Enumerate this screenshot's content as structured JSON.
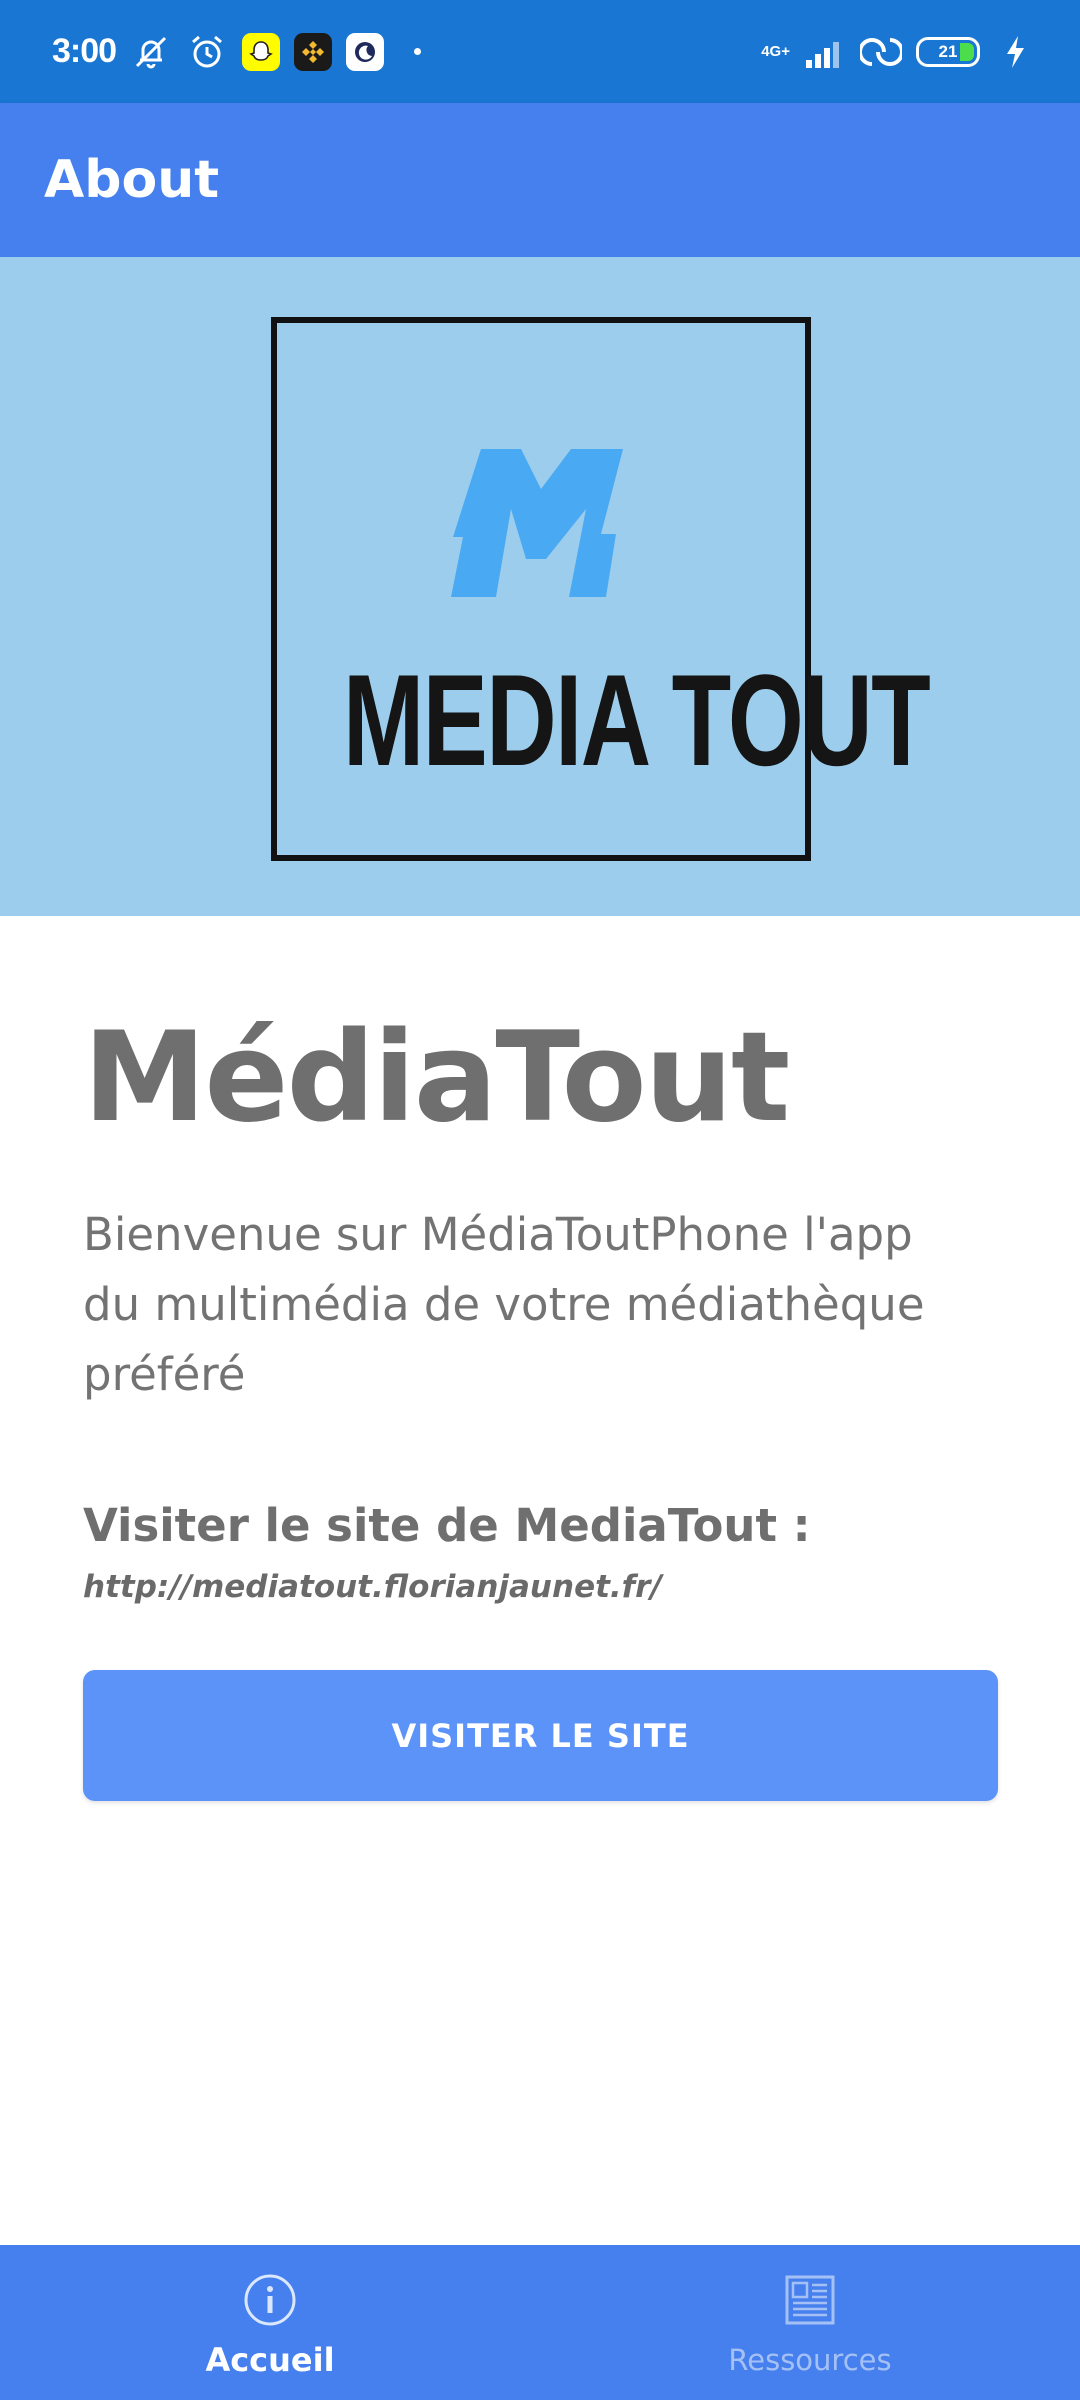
{
  "status_bar": {
    "time": "3:00",
    "network": "4G+",
    "battery": "21",
    "icons": [
      "muted-bell-icon",
      "alarm-icon",
      "snapchat-icon",
      "binance-icon",
      "moon-icon",
      "signal-icon",
      "hotspot-icon",
      "battery-icon",
      "charging-icon"
    ]
  },
  "app_bar": {
    "title": "About"
  },
  "hero": {
    "logo_text": "MEDIA TOUT",
    "logo_accent": "#4aa9f3"
  },
  "main": {
    "app_name": "MédiaTout",
    "welcome": "Bienvenue sur MédiaToutPhone l'app du multimédia de votre médiathèque préféré",
    "visit_label": "Visiter le site de MediaTout : ",
    "visit_url": "http://mediatout.florianjaunet.fr/",
    "button_label": "VISITER LE SITE"
  },
  "bottom_nav": {
    "items": [
      {
        "label": "Accueil",
        "icon": "info-icon",
        "active": true
      },
      {
        "label": "Ressources",
        "icon": "document-icon",
        "active": false
      }
    ]
  },
  "colors": {
    "status_bar": "#1976d2",
    "primary": "#4680ee",
    "button": "#5b93f9",
    "hero_bg": "#9ccdec"
  }
}
